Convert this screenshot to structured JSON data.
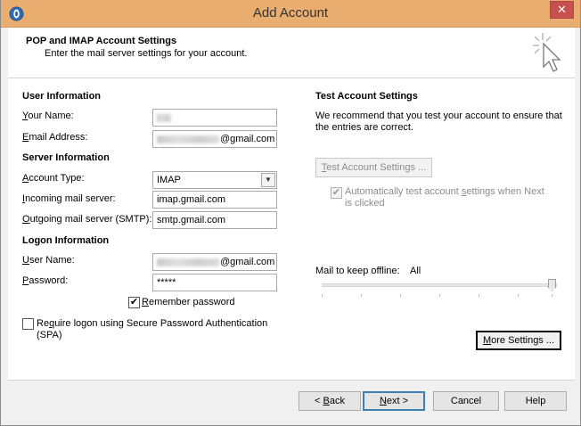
{
  "window": {
    "title": "Add Account",
    "close_glyph": "✕"
  },
  "header": {
    "title": "POP and IMAP Account Settings",
    "subtitle": "Enter the mail server settings for your account."
  },
  "user_info": {
    "section": "User Information",
    "name_label_u": "Y",
    "name_label_rest": "our Name:",
    "email_label_u": "E",
    "email_label_rest": "mail Address:",
    "email_suffix": "@gmail.com"
  },
  "server_info": {
    "section": "Server Information",
    "account_type_label_u": "A",
    "account_type_label_rest": "ccount Type:",
    "account_type_value": "IMAP",
    "incoming_label_u": "I",
    "incoming_label_rest": "ncoming mail server:",
    "incoming_value": "imap.gmail.com",
    "outgoing_label_u": "O",
    "outgoing_label_rest": "utgoing mail server (SMTP):",
    "outgoing_value": "smtp.gmail.com"
  },
  "logon_info": {
    "section": "Logon Information",
    "username_label_u": "U",
    "username_label_rest": "ser Name:",
    "username_suffix": "@gmail.com",
    "password_label_u": "P",
    "password_label_rest": "assword:",
    "password_value": "*****",
    "remember_label_u": "R",
    "remember_label_rest": "emember password",
    "remember_checked": "✔",
    "spa_label_line1_u": "q",
    "spa_label_line1_pre": "Re",
    "spa_label_line1_rest": "uire logon using Secure Password Authentication",
    "spa_label_line2": "(SPA)"
  },
  "test_settings": {
    "section": "Test Account Settings",
    "description": "We recommend that you test your account to ensure that the entries are correct.",
    "button_u": "T",
    "button_rest": "est Account Settings ...",
    "auto_test_pre": "Automatically test account ",
    "auto_test_u": "s",
    "auto_test_rest": "ettings when Next",
    "auto_test_line2": "is clicked",
    "auto_test_checked": "✔"
  },
  "offline": {
    "label": "Mail to keep offline:",
    "value": "All",
    "level_percent": 100
  },
  "more_settings": {
    "label_u": "M",
    "label_rest": "ore Settings ..."
  },
  "footer": {
    "back_pre": "< ",
    "back_u": "B",
    "back_rest": "ack",
    "next_u": "N",
    "next_rest": "ext >",
    "cancel": "Cancel",
    "help": "Help"
  }
}
